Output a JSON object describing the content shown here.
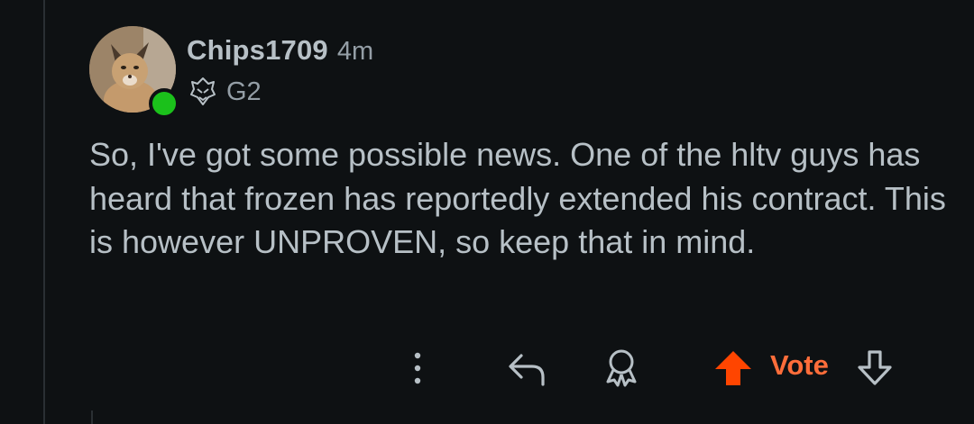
{
  "comment": {
    "username": "Chips1709",
    "time_ago": "4m",
    "flair": {
      "icon": "g2-esports-logo-icon",
      "text": "G2"
    },
    "online_status": "online",
    "body": "So, I've got some possible news. One of the hltv guys has heard that frozen has reportedly extended his contract. This is however UNPROVEN, so keep that in mind."
  },
  "actions": {
    "more_icon": "more-vertical-icon",
    "reply_icon": "reply-arrow-icon",
    "award_icon": "award-icon",
    "upvote_icon": "upvote-arrow-icon",
    "vote_label": "Vote",
    "downvote_icon": "downvote-arrow-icon"
  },
  "colors": {
    "background": "#0e1113",
    "text": "#b7c0c6",
    "muted": "#949ea6",
    "upvote_active": "#ff4500",
    "vote_label": "#ff6d3a",
    "online": "#1bc11b"
  }
}
